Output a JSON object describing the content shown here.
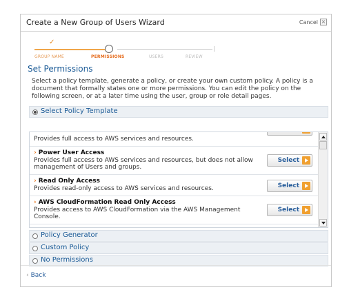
{
  "dialog": {
    "title": "Create a New Group of Users Wizard",
    "cancel_label": "Cancel",
    "cancel_icon": "close-icon"
  },
  "steps": {
    "done_mark": "✓",
    "items": [
      {
        "label": "GROUP NAME",
        "state": "done"
      },
      {
        "label": "PERMISSIONS",
        "state": "current"
      },
      {
        "label": "USERS",
        "state": "todo"
      },
      {
        "label": "REVIEW",
        "state": "todo"
      }
    ]
  },
  "page": {
    "heading": "Set Permissions",
    "intro": "Select a policy template, generate a policy, or create your own custom policy. A policy is a document that formally states one or more permissions. You can edit the policy on the following screen, or at a later time using the user, group or role detail pages."
  },
  "sections": [
    {
      "title": "Select Policy Template",
      "selected": true
    },
    {
      "title": "Policy Generator",
      "selected": false
    },
    {
      "title": "Custom Policy",
      "selected": false
    },
    {
      "title": "No Permissions",
      "selected": false
    }
  ],
  "policies": {
    "select_label": "Select",
    "arrow": "›",
    "items": [
      {
        "name": "",
        "desc": "Provides full access to AWS services and resources."
      },
      {
        "name": "Power User Access",
        "desc": "Provides full access to AWS services and resources, but does not allow management of Users and groups."
      },
      {
        "name": "Read Only Access",
        "desc": "Provides read-only access to AWS services and resources."
      },
      {
        "name": "AWS CloudFormation Read Only Access",
        "desc": "Provides access to AWS CloudFormation via the AWS Management Console."
      }
    ]
  },
  "footer": {
    "back_label": "Back",
    "back_chevron": "‹"
  },
  "colors": {
    "accent_orange": "#f0a030",
    "link_blue": "#1a5a96",
    "section_bg": "#ecf0f4"
  }
}
